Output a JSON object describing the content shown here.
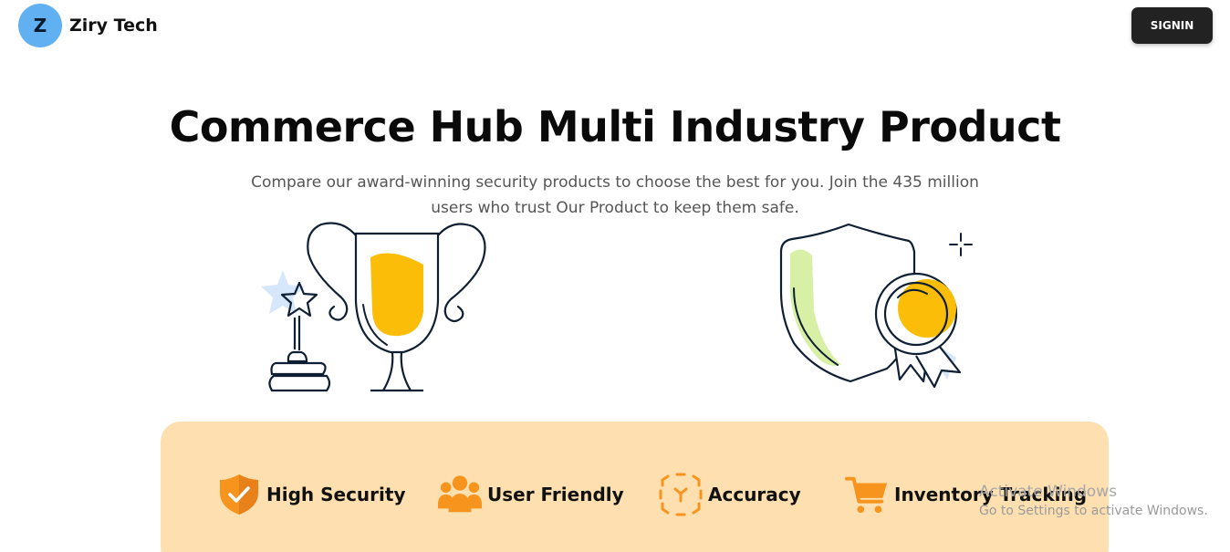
{
  "header": {
    "logo_letter": "Z",
    "brand_name": "Ziry Tech",
    "signin_label": "SIGNIN"
  },
  "hero": {
    "title": "Commerce Hub Multi Industry Product",
    "subtitle": "Compare our award-winning security products to choose the best for you. Join the 435 million users who trust Our Product to keep them safe."
  },
  "illustrations": {
    "left": "trophy-icon",
    "right": "shield-badge-icon"
  },
  "features": [
    {
      "label": "High Security",
      "icon": "shield-check-icon"
    },
    {
      "label": "User Friendly",
      "icon": "users-icon"
    },
    {
      "label": "Accuracy",
      "icon": "target-icon"
    },
    {
      "label": "Inventory Tracking",
      "icon": "cart-icon"
    }
  ],
  "watermark": {
    "title": "Activate Windows",
    "subtitle": "Go to Settings to activate Windows."
  },
  "colors": {
    "brand_blue": "#60B0F2",
    "accent_orange": "#F7941D",
    "gold": "#FBBD08",
    "band": "#FDDFB0",
    "button": "#222222"
  }
}
